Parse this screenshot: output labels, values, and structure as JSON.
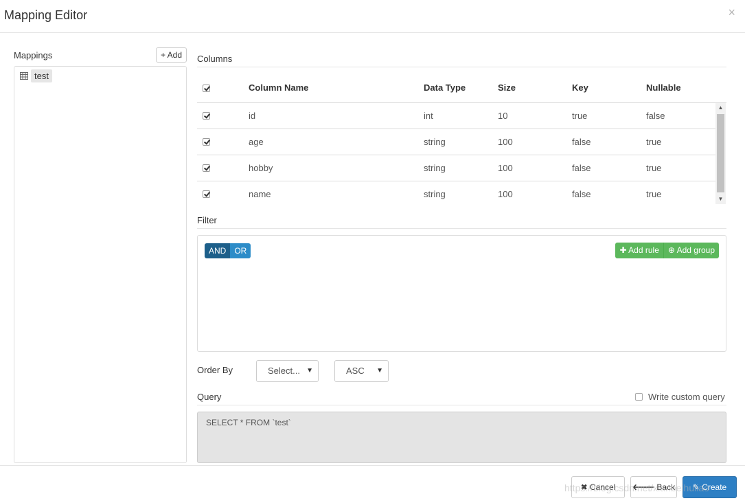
{
  "header": {
    "title": "Mapping Editor",
    "close_label": "×"
  },
  "mappings": {
    "label": "Mappings",
    "add_label": "+ Add",
    "items": [
      {
        "label": "test"
      }
    ]
  },
  "columns": {
    "section_label": "Columns",
    "headers": [
      "Column Name",
      "Data Type",
      "Size",
      "Key",
      "Nullable"
    ],
    "rows": [
      {
        "name": "id",
        "type": "int",
        "size": "10",
        "key": "true",
        "nullable": "false"
      },
      {
        "name": "age",
        "type": "string",
        "size": "100",
        "key": "false",
        "nullable": "true"
      },
      {
        "name": "hobby",
        "type": "string",
        "size": "100",
        "key": "false",
        "nullable": "true"
      },
      {
        "name": "name",
        "type": "string",
        "size": "100",
        "key": "false",
        "nullable": "true"
      }
    ]
  },
  "filter": {
    "section_label": "Filter",
    "and_label": "AND",
    "or_label": "OR",
    "add_rule_label": "Add rule",
    "add_group_label": "Add group"
  },
  "order": {
    "label": "Order By",
    "field_value": "Select...",
    "direction_value": "ASC"
  },
  "query": {
    "section_label": "Query",
    "custom_label": "Write custom query",
    "sql": "SELECT * FROM `test`"
  },
  "footer": {
    "cancel_label": "Cancel",
    "back_label": "Back",
    "create_label": "Create"
  },
  "watermark": "https://blog.csdn.net/xianbeihuliao",
  "colors": {
    "primary": "#2d7fc4",
    "success": "#5cb85c",
    "and": "#1d5f8a",
    "or": "#2d8cc8"
  }
}
